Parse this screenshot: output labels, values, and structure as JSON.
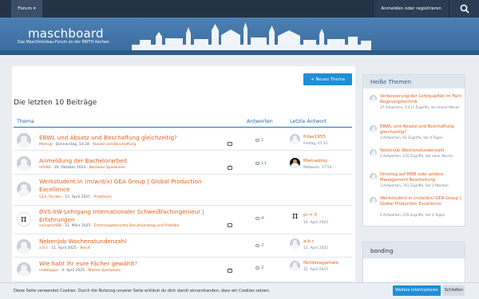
{
  "nav": {
    "forum_label": "Forum",
    "login_label": "Anmelden oder registrieren"
  },
  "header": {
    "logo_text": "maschboard",
    "tagline": "Das Maschinenbau-Forum an der RWTH Aachen"
  },
  "main": {
    "new_topic_label": "Neues Thema",
    "page_title": "Die letzten 10 Beiträge",
    "columns": {
      "topic": "Thema",
      "replies": "Antworten",
      "last_reply": "Letzte Antwort"
    },
    "rows": [
      {
        "title": "EBWL und Absatz und Beschaffung gleichzeitig?",
        "author": "Memojj",
        "date": "Donnerstag, 13:34",
        "category": "Absatz und Beschaffung",
        "replies": "1",
        "last_user": "frilas1955",
        "last_date": "Freitag, 07:21"
      },
      {
        "title": "Anmeldung der Bachelorarbeit",
        "author": "mfe90",
        "date": "30. Oktober 2024",
        "category": "Bachelor Spielwiese",
        "replies": "11",
        "last_user": "Mamasboy",
        "last_date": "Mittwoch, 17:59"
      },
      {
        "title": "Werkstudent:in (m/w/d/x) GEA Group | Global Production Excellence",
        "author": "GEA_Torsten",
        "date": "15. April 2025",
        "category": "Praktikum",
        "replies": "",
        "last_user": "",
        "last_date": ""
      },
      {
        "title": "DVS-IIW-Lehrgang Internationaler Schweißfachingenieur | Erfahrungen",
        "author": "samamch88",
        "date": "31. März 2025",
        "category": "Erfahrungsberichte Berufseinstieg und Praktika",
        "replies": "4",
        "last_user": "pi = 3",
        "last_date": "14. April 2025"
      },
      {
        "title": "Nebenjob Wochenstundenzahl",
        "author": "a.b.c",
        "date": "11. April 2025",
        "category": "Beruf",
        "replies": "2",
        "last_user": "a.b.c",
        "last_date": "12. April 2025"
      },
      {
        "title": "Wie habt ihr eure Fächer gewählt?",
        "author": "nudeluppe",
        "date": "4. April 2025",
        "category": "Master Spielwiese",
        "replies": "2",
        "last_user": "Nordseegamele",
        "last_date": "12. April 2025"
      }
    ]
  },
  "sidebar": {
    "hot_title": "Heiße Themen",
    "hot": [
      {
        "title": "Verbesserung der Lehrqualität im Fach Regelungstechnik",
        "meta": "37 Antworten, 5.417 Zugriffe, Vor einem Monat"
      },
      {
        "title": "EBWL und Absatz und Beschaffung gleichzeitig?",
        "meta": "1 Antworten, 81 Zugriffe, Vor 4 Tagen"
      },
      {
        "title": "Nebenjob Wochenstundenzahl",
        "meta": "2 Antworten, 210 Zugriffe, Vor einer Woche"
      },
      {
        "title": "Umstieg auf MBB oder andere Management Bearbeitung",
        "meta": "3 Antworten, 741 Zugriffe, Vor 2 Wochen"
      },
      {
        "title": "Werkstudent:in (m/w/d/x) GEA Group | Global Production Excellence",
        "meta": "0 Antworten, 105 Zugriffe, Vor 6 Tagen"
      }
    ],
    "box2_title": "bonding"
  },
  "cookie": {
    "text": "Diese Seite verwendet Cookies. Durch die Nutzung unserer Seite erklärst du dich damit einverstanden, dass wir Cookies setzen.",
    "more_label": "Weitere Informationen",
    "close_label": "Schließen"
  },
  "icons": {
    "search": "search-icon",
    "dropdown": "chevron-down-icon",
    "add": "plus-icon",
    "replies": "comment-icon"
  },
  "colors": {
    "nav": "#243447",
    "header": "#4677a8",
    "accent": "#e0611a",
    "link_blue": "#2a6bb0",
    "button": "#1f8fd6"
  }
}
